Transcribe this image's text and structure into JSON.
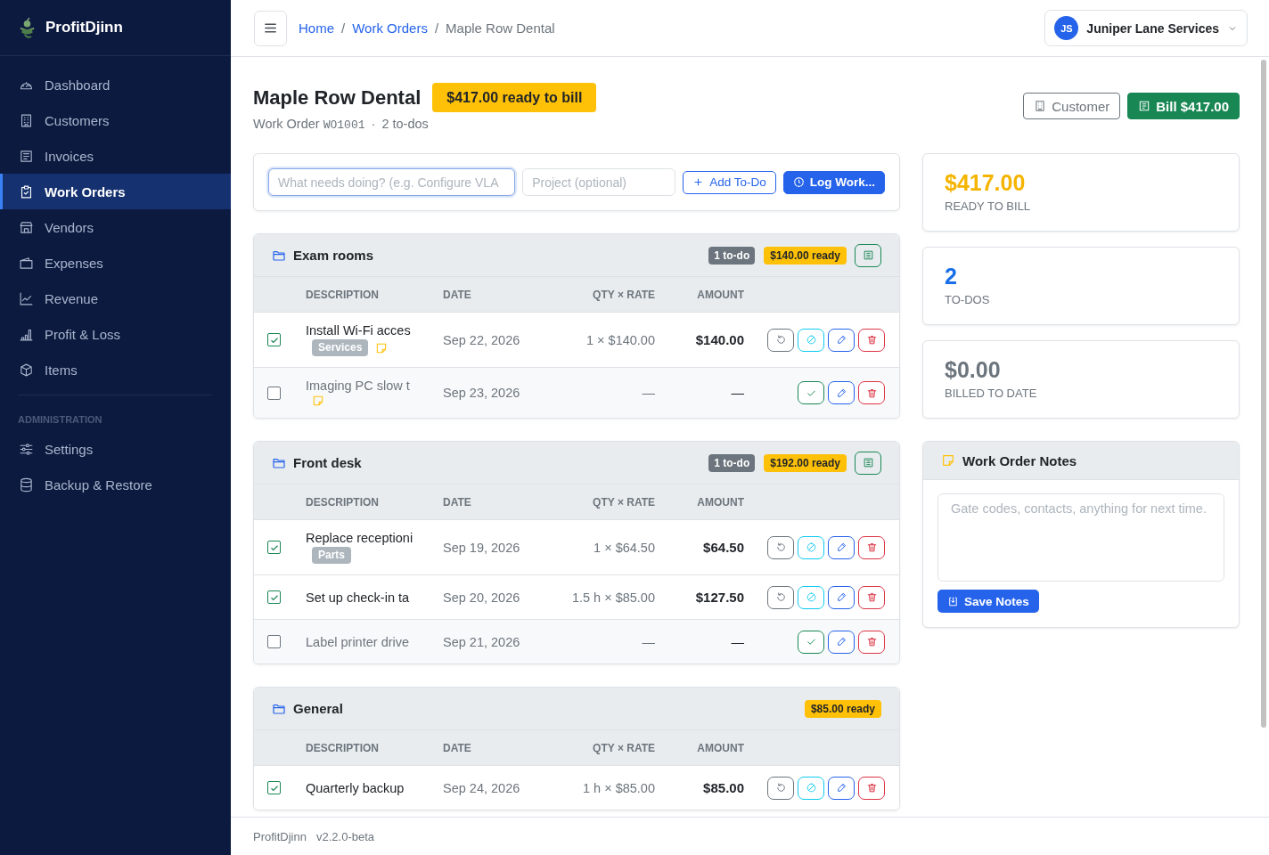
{
  "sidebar": {
    "brand": "ProfitDjinn",
    "items": [
      {
        "label": "Dashboard",
        "selected": false
      },
      {
        "label": "Customers",
        "selected": false
      },
      {
        "label": "Invoices",
        "selected": false
      },
      {
        "label": "Work Orders",
        "selected": true
      },
      {
        "label": "Vendors",
        "selected": false
      },
      {
        "label": "Expenses",
        "selected": false
      },
      {
        "label": "Revenue",
        "selected": false
      },
      {
        "label": "Profit & Loss",
        "selected": false
      },
      {
        "label": "Items",
        "selected": false
      }
    ],
    "section_label": "ADMINISTRATION",
    "admin_items": [
      {
        "label": "Settings",
        "selected": false
      },
      {
        "label": "Backup & Restore",
        "selected": false
      }
    ]
  },
  "header": {
    "breadcrumb": [
      {
        "label": "Home",
        "kind": "link",
        "separator": "/"
      },
      {
        "label": "Work Orders",
        "kind": "link",
        "separator": "/"
      },
      {
        "label": "Maple Row Dental",
        "kind": "current"
      }
    ],
    "account": {
      "initials": "JS",
      "name": "Juniper Lane Services"
    }
  },
  "page": {
    "title": "Maple Row Dental",
    "status_badge": "$417.00 ready to bill",
    "subtitle": {
      "label": "Work Order",
      "number": "WO1001",
      "separator": "·",
      "todos": "2 to-dos"
    },
    "actions": [
      {
        "label": "Customer",
        "kind": "outline"
      },
      {
        "label": "Bill $417.00",
        "kind": "success"
      }
    ]
  },
  "add_form": {
    "task_placeholder": "What needs doing? (e.g. Configure VLA",
    "task_focused": true,
    "project_placeholder": "Project (optional)",
    "buttons": [
      {
        "label": "Add To-Do",
        "kind": "outline"
      },
      {
        "label": "Log Work...",
        "kind": "primary"
      }
    ]
  },
  "groups": [
    {
      "name": "Exam rooms",
      "todo_badge": "1 to-do",
      "ready_badge": "$140.00 ready",
      "bill_button": true,
      "columns": [
        "DESCRIPTION",
        "DATE",
        "QTY × RATE",
        "AMOUNT"
      ],
      "rows": [
        {
          "description": "Install Wi-Fi acces",
          "tag": "Services",
          "has_note": true,
          "checked": true,
          "date": "Sep 22, 2026",
          "qty_rate": "1 × $140.00",
          "amount": "$140.00"
        },
        {
          "description": "Imaging PC slow t",
          "has_note": true,
          "checked": false,
          "date": "Sep 23, 2026",
          "qty_rate": "—",
          "amount": "—"
        }
      ]
    },
    {
      "name": "Front desk",
      "todo_badge": "1 to-do",
      "ready_badge": "$192.00 ready",
      "bill_button": true,
      "columns": [
        "DESCRIPTION",
        "DATE",
        "QTY × RATE",
        "AMOUNT"
      ],
      "rows": [
        {
          "description": "Replace receptioni",
          "tag": "Parts",
          "has_note": false,
          "checked": true,
          "date": "Sep 19, 2026",
          "qty_rate": "1 × $64.50",
          "amount": "$64.50"
        },
        {
          "description": "Set up check-in ta",
          "has_note": false,
          "checked": true,
          "date": "Sep 20, 2026",
          "qty_rate": "1.5 h × $85.00",
          "amount": "$127.50"
        },
        {
          "description": "Label printer drive",
          "has_note": false,
          "checked": false,
          "date": "Sep 21, 2026",
          "qty_rate": "—",
          "amount": "—"
        }
      ]
    },
    {
      "name": "General",
      "ready_badge": "$85.00 ready",
      "bill_button": false,
      "columns": [
        "DESCRIPTION",
        "DATE",
        "QTY × RATE",
        "AMOUNT"
      ],
      "rows": [
        {
          "description": "Quarterly backup",
          "has_note": false,
          "checked": true,
          "date": "Sep 24, 2026",
          "qty_rate": "1 h × $85.00",
          "amount": "$85.00"
        }
      ]
    }
  ],
  "stats": [
    {
      "value": "$417.00",
      "label": "READY TO BILL",
      "color": "#f5b400"
    },
    {
      "value": "2",
      "label": "TO-DOS",
      "color": "#1a6fe8"
    },
    {
      "value": "$0.00",
      "label": "BILLED TO DATE",
      "color": "#6c757d"
    }
  ],
  "notes": {
    "title": "Work Order Notes",
    "placeholder": "Gate codes, contacts, anything for next time.",
    "button": "Save Notes"
  },
  "footer": {
    "app": "ProfitDjinn",
    "version": "v2.2.0-beta"
  }
}
